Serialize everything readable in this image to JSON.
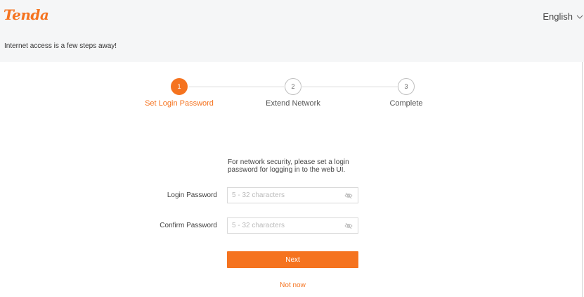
{
  "header": {
    "logo_text": "Tenda",
    "language": "English",
    "tagline": "Internet access is a few steps away!"
  },
  "steps": [
    {
      "number": "1",
      "label": "Set Login Password",
      "active": true
    },
    {
      "number": "2",
      "label": "Extend Network",
      "active": false
    },
    {
      "number": "3",
      "label": "Complete",
      "active": false
    }
  ],
  "form": {
    "hint": "For network security, please set a login password for logging in to the web UI.",
    "login_password_label": "Login Password",
    "login_password_placeholder": "5 - 32 characters",
    "login_password_value": "",
    "confirm_password_label": "Confirm Password",
    "confirm_password_placeholder": "5 - 32 characters",
    "confirm_password_value": "",
    "next_label": "Next",
    "not_now_label": "Not now"
  },
  "colors": {
    "accent": "#f5731f",
    "header_bg": "#f5f6f7"
  },
  "icons": {
    "language_dropdown": "chevron-down-icon",
    "password_toggle": "eye-off-icon"
  }
}
